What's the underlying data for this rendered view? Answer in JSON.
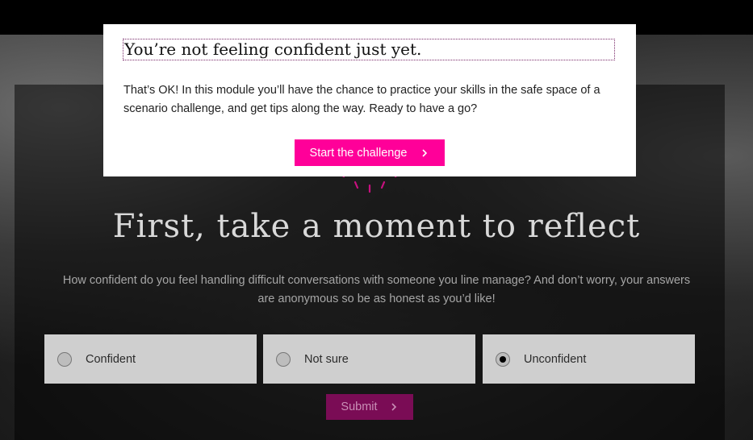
{
  "modal": {
    "title": "You’re not feeling confident just yet.",
    "body": "That’s OK! In this module you’ll have the chance to practice your skills in the safe space of a scenario challenge, and get tips along the way. Ready to have a go?",
    "button_label": "Start the challenge",
    "button_icon": "chevron-right-icon"
  },
  "reflect": {
    "title": "First, take a moment to reflect",
    "question": "How confident do you feel handling difficult conversations with someone you line manage? And don’t worry, your answers are anonymous so be as honest as you’d like!",
    "options": [
      {
        "label": "Confident",
        "selected": false
      },
      {
        "label": "Not sure",
        "selected": false
      },
      {
        "label": "Unconfident",
        "selected": true
      }
    ],
    "submit_label": "Submit"
  },
  "colors": {
    "accent": "#ff0099",
    "submit_disabled": "#7a0c55"
  }
}
